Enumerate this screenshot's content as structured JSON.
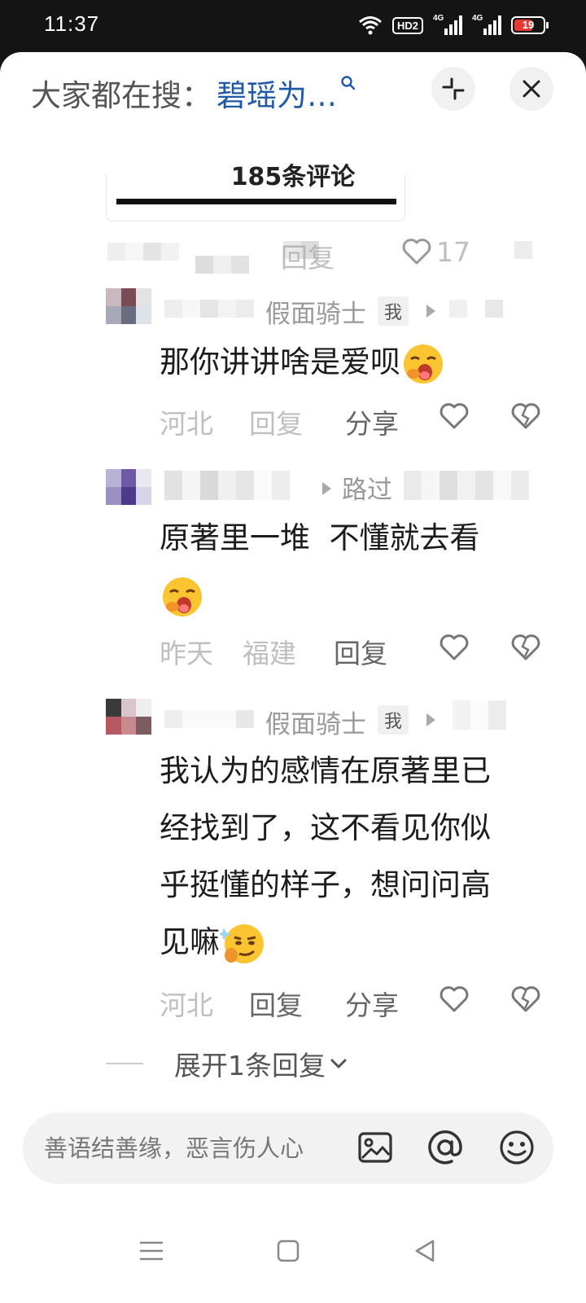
{
  "status_bar": {
    "time": "11:37",
    "hd_label": "HD2",
    "network_1": "4G",
    "network_2": "4G",
    "battery": "19"
  },
  "header": {
    "search_prefix": "大家都在搜：",
    "search_term": "碧瑶为…",
    "icons": [
      "search-icon",
      "collapse-icon",
      "close-icon"
    ]
  },
  "comments_count": "185条评论",
  "top_actions": {
    "reply": "回复",
    "likes": "17"
  },
  "comments": [
    {
      "username_fragment": "假面骑士",
      "me_badge": "我",
      "text": "那你讲讲啥是爱呗",
      "emoji": "yawning-face",
      "location": "河北",
      "reply": "回复",
      "share": "分享"
    },
    {
      "username_fragment": "路过",
      "text": "原著里一堆  不懂就去看",
      "emoji": "yawning-face",
      "time_fragment": "昨天",
      "location": "福建",
      "reply": "回复"
    },
    {
      "username_fragment": "假面骑士",
      "me_badge": "我",
      "text_lines": [
        "我认为的感情在原著里已",
        "经找到了，这不看见你似",
        "乎挺懂的样子，想问问高",
        "见嘛"
      ],
      "emoji": "smirking-thinking-face",
      "location": "河北",
      "reply": "回复",
      "share": "分享"
    }
  ],
  "expand_replies": "展开1条回复",
  "input": {
    "placeholder": "善语结善缘，恶言伤人心"
  },
  "colors": {
    "accent": "#1e5aa8",
    "status_bar_bg": "#141414",
    "battery_low": "#e53935"
  }
}
